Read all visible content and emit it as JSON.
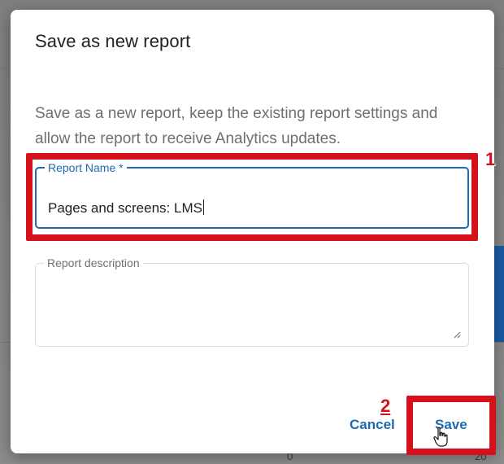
{
  "dialog": {
    "title": "Save as new report",
    "description": "Save as a new report, keep the existing report settings and allow the report to receive Analytics updates."
  },
  "fields": {
    "report_name": {
      "label": "Report Name *",
      "value": "Pages and screens: LMS"
    },
    "report_description": {
      "label": "Report description",
      "value": ""
    }
  },
  "actions": {
    "cancel_label": "Cancel",
    "save_label": "Save"
  },
  "annotations": {
    "step_1": "1",
    "step_2": "2"
  },
  "background": {
    "axis_labels": [
      "0",
      "20"
    ]
  },
  "colors": {
    "accent": "#1f6ab3",
    "annotation": "#d4111b",
    "background_blue": "#1a5aa6"
  }
}
